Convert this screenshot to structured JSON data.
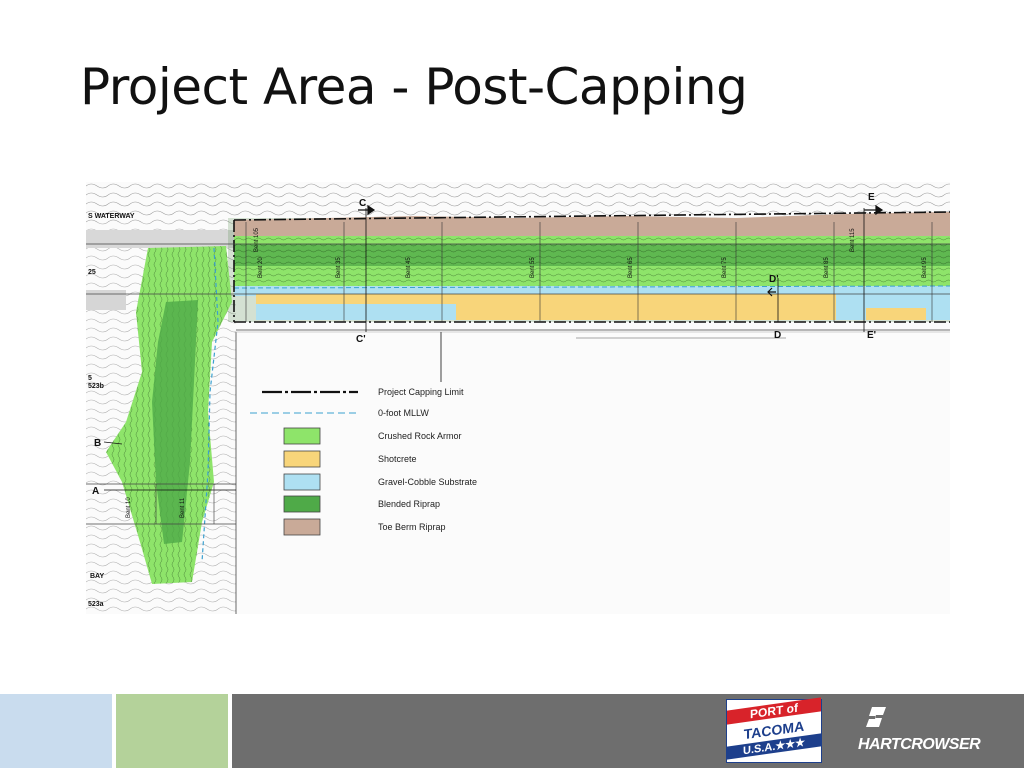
{
  "slide": {
    "title": "Project Area - Post-Capping"
  },
  "map": {
    "labels": {
      "waterway": "S WATERWAY",
      "bay": "BAY",
      "side_25": "25",
      "side_5": "5",
      "side_523b": "523b",
      "side_523a": "523a"
    },
    "sections": {
      "A": "A",
      "B": "B",
      "C": "C",
      "C_prime": "C'",
      "D": "D",
      "D_prime": "D'",
      "E": "E",
      "E_prime": "E'"
    },
    "bents": {
      "b10": "Bent 10",
      "b11": "Bent 11",
      "b20": "Bent 20",
      "b35": "Bent 35",
      "b45": "Bent 45",
      "b55": "Bent 55",
      "b65": "Bent 65",
      "b75": "Bent 75",
      "b85": "Bent 85",
      "b95": "Bent 95",
      "b105": "Bent 105",
      "b115": "Bent 115"
    },
    "colors": {
      "crushed_rock_armor": "#8ee46a",
      "shotcrete": "#f8d57a",
      "gravel_cobble_substrate": "#aee0f2",
      "blended_riprap": "#4faa48",
      "toe_berm_riprap": "#c9aa98"
    }
  },
  "legend": {
    "project_capping_limit": "Project Capping Limit",
    "mllw": "0-foot MLLW",
    "crushed_rock_armor": "Crushed Rock Armor",
    "shotcrete": "Shotcrete",
    "gravel_cobble_substrate": "Gravel-Cobble Substrate",
    "blended_riprap": "Blended Riprap",
    "toe_berm_riprap": "Toe Berm Riprap"
  },
  "footer": {
    "port_logo": {
      "line1": "PORT of",
      "line2": "TACOMA",
      "line3": "U.S.A.★★★"
    },
    "company": "HARTCROWSER"
  }
}
